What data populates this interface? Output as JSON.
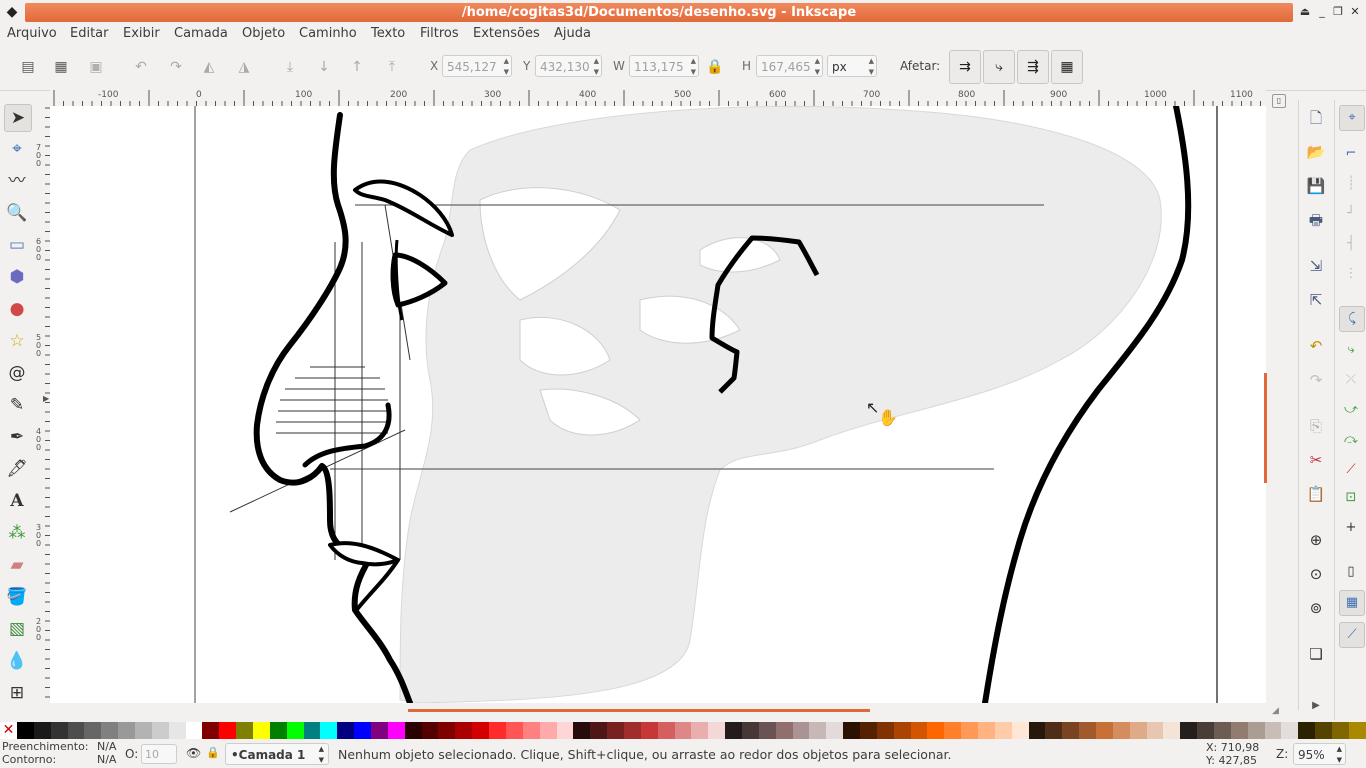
{
  "window": {
    "title": "/home/cogitas3d/Documentos/desenho.svg - Inkscape"
  },
  "menu": [
    "Arquivo",
    "Editar",
    "Exibir",
    "Camada",
    "Objeto",
    "Caminho",
    "Texto",
    "Filtros",
    "Extensões",
    "Ajuda"
  ],
  "toolbar": {
    "x_label": "X",
    "x_value": "545,127",
    "y_label": "Y",
    "y_value": "432,130",
    "w_label": "W",
    "w_value": "113,175",
    "h_label": "H",
    "h_value": "167,465",
    "unit": "px",
    "affect_label": "Afetar:"
  },
  "ruler": {
    "h_labels": [
      "-100",
      "0",
      "100",
      "200",
      "300",
      "400",
      "500",
      "600",
      "700",
      "800",
      "900",
      "1000",
      "1100"
    ],
    "v_labels": [
      "700",
      "600",
      "500",
      "400",
      "300",
      "200"
    ]
  },
  "palette": [
    "#000000",
    "#1a1a1a",
    "#333333",
    "#4d4d4d",
    "#666666",
    "#808080",
    "#999999",
    "#b3b3b3",
    "#cccccc",
    "#e6e6e6",
    "#ffffff",
    "#800000",
    "#ff0000",
    "#808000",
    "#ffff00",
    "#008000",
    "#00ff00",
    "#008080",
    "#00ffff",
    "#000080",
    "#0000ff",
    "#800080",
    "#ff00ff",
    "#2b0000",
    "#550000",
    "#800000",
    "#aa0000",
    "#d40000",
    "#ff2a2a",
    "#ff5555",
    "#ff8080",
    "#ffaaaa",
    "#ffd5d5",
    "#280b0b",
    "#501616",
    "#782121",
    "#a02c2c",
    "#c83737",
    "#d35f5f",
    "#de8787",
    "#e9afaf",
    "#f4d7d7",
    "#241c1c",
    "#483737",
    "#6c5353",
    "#916f6f",
    "#ac9393",
    "#c8b7b7",
    "#e3dbdb",
    "#2b1100",
    "#552200",
    "#803300",
    "#aa4400",
    "#d45500",
    "#ff6600",
    "#ff7f2a",
    "#ff9955",
    "#ffb380",
    "#ffccaa",
    "#ffe6d5",
    "#28170b",
    "#502d16",
    "#784421",
    "#a05a2c",
    "#c87137",
    "#d38d5f",
    "#deaa87",
    "#e9c6af",
    "#f4e3d7",
    "#241f1c",
    "#483e37",
    "#6c5d53",
    "#917c6f",
    "#ac9d93",
    "#c8beb7",
    "#e3dedb",
    "#2b2200",
    "#554400",
    "#806600",
    "#aa8800"
  ],
  "status": {
    "fill_label": "Preenchimento:",
    "fill_value": "N/A",
    "stroke_label": "Contorno:",
    "stroke_value": "N/A",
    "opacity_label": "O:",
    "opacity_value": "10",
    "layer": "•Camada 1",
    "message": "Nenhum objeto selecionado. Clique, Shift+clique, ou arraste ao redor dos objetos para selecionar.",
    "cursor_x": "X: 710,98",
    "cursor_y": "Y: 427,85",
    "zoom_label": "Z:",
    "zoom_value": "95%"
  }
}
